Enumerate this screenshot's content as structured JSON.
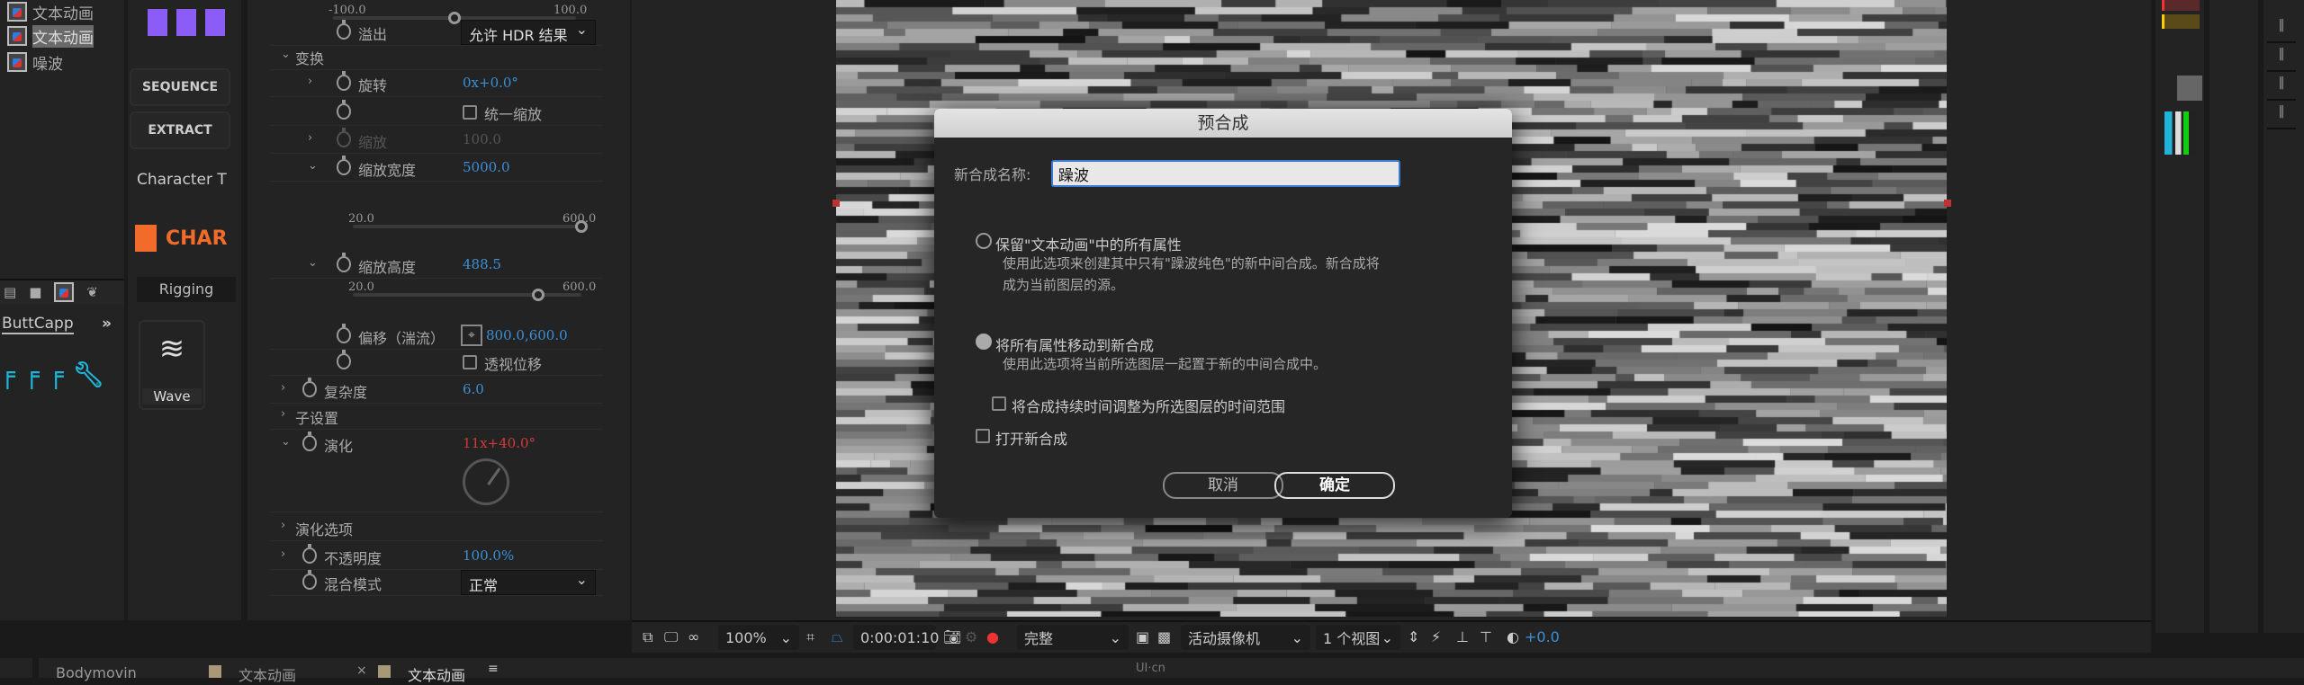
{
  "project": {
    "items": [
      "文本动画",
      "文本动画",
      "噪波"
    ],
    "selected_index": 1
  },
  "ext_panel": {
    "sequence": "SEQUENCE",
    "extract": "EXTRACT",
    "character_tab": "Character T",
    "char_logo": "CHAR",
    "rigging": "Rigging",
    "wave": "Wave",
    "buttcapp": "ButtCapp",
    "more": "»"
  },
  "effects": {
    "top_slider": {
      "min": "-100.0",
      "max": "100.0",
      "value": 0
    },
    "overflow": {
      "label": "溢出",
      "value": "允许 HDR 结果"
    },
    "transform": "变换",
    "rotation": {
      "label": "旋转",
      "value": "0x+0.0°"
    },
    "uniform_scale": {
      "label": "统一缩放",
      "checked": false
    },
    "scale": {
      "label": "缩放",
      "value": "100.0"
    },
    "scale_width": {
      "label": "缩放宽度",
      "value": "5000.0",
      "min": "20.0",
      "max": "600.0",
      "fraction": 1.0
    },
    "scale_height": {
      "label": "缩放高度",
      "value": "488.5",
      "min": "20.0",
      "max": "600.0",
      "fraction": 0.81
    },
    "offset": {
      "label": "偏移（湍流）",
      "value": "800.0,600.0"
    },
    "perspective": {
      "label": "透视位移",
      "checked": false
    },
    "complexity": {
      "label": "复杂度",
      "value": "6.0"
    },
    "sub_settings": "子设置",
    "evolution": {
      "label": "演化",
      "value": "11x+40.0°",
      "color": "#d23a3a"
    },
    "evolution_options": "演化选项",
    "opacity": {
      "label": "不透明度",
      "value": "100.0%"
    },
    "blend": {
      "label": "混合模式",
      "value": "正常"
    }
  },
  "toolbar": {
    "zoom": "100%",
    "timecode": "0:00:01:10",
    "quality": "完整",
    "camera": "活动摄像机",
    "views": "1 个视图",
    "exposure": "+0.0"
  },
  "dialog": {
    "title": "预合成",
    "name_label": "新合成名称:",
    "name_value": "躁波",
    "option1": "保留\"文本动画\"中的所有属性",
    "option1_desc": "使用此选项来创建其中只有\"躁波纯色\"的新中间合成。新合成将成为当前图层的源。",
    "option2": "将所有属性移动到新合成",
    "option2_desc": "使用此选项将当前所选图层一起置于新的中间合成中。",
    "adjust_duration": "将合成持续时间调整为所选图层的时间范围",
    "open_new": "打开新合成",
    "cancel": "取消",
    "ok": "确定",
    "selected_option": 2
  },
  "bottom_tabs": [
    {
      "label": "Bodymovin"
    },
    {
      "label": "文本动画",
      "close": "×"
    },
    {
      "label": "文本动画",
      "menu": "≡"
    }
  ],
  "watermark": "UI·cn",
  "colors": {
    "accent_blue": "#3b8fd6",
    "char_orange": "#f26b2a",
    "purple": "#8b5cf6",
    "cyan": "#1fb4d8"
  }
}
